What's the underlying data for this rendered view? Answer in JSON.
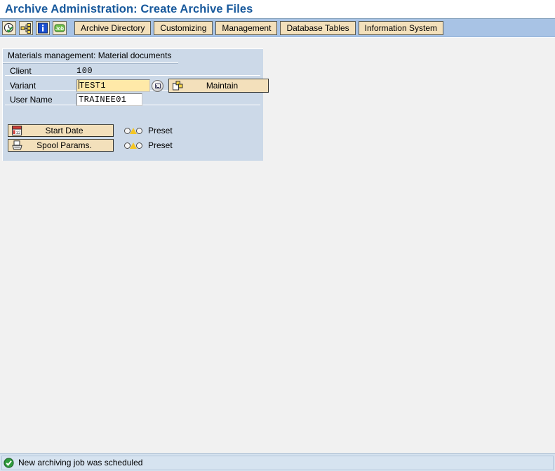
{
  "window": {
    "title": "Archive Administration: Create Archive Files"
  },
  "toolbar": {
    "icons": [
      {
        "name": "schedule-clock-icon",
        "label": "Execute / Schedule"
      },
      {
        "name": "hierarchy-network-icon",
        "label": "Object Hierarchy"
      },
      {
        "name": "info-icon",
        "label": "Information"
      },
      {
        "name": "job-icon",
        "label": "Job Overview"
      }
    ],
    "buttons": [
      {
        "label": "Archive Directory"
      },
      {
        "label": "Customizing"
      },
      {
        "label": "Management"
      },
      {
        "label": "Database Tables"
      },
      {
        "label": "Information System"
      }
    ]
  },
  "panel": {
    "header": "Materials management: Material documents",
    "fields": {
      "client": {
        "label": "Client",
        "value": "100"
      },
      "variant": {
        "label": "Variant",
        "value": "TEST1",
        "placeholder": "",
        "f4_help_name": "value-help-icon"
      },
      "user_name": {
        "label": "User Name",
        "value": "TRAINEE01",
        "placeholder": ""
      }
    },
    "maintain_button": {
      "label": "Maintain",
      "icon": "variant-maintain-icon"
    },
    "actions": [
      {
        "label": "Start Date",
        "icon": "calendar-icon",
        "status": "Preset",
        "status_indicator": "warning-triangle"
      },
      {
        "label": "Spool Params.",
        "icon": "printer-icon",
        "status": "Preset",
        "status_indicator": "warning-triangle"
      }
    ]
  },
  "statusbar": {
    "icon": "success-check-icon",
    "message": "New archiving job was scheduled"
  },
  "colors": {
    "title_text": "#18599c",
    "toolbar_bg": "#a8c3e5",
    "button_bg": "#f3e0bb",
    "panel_bg": "#ccd9e8",
    "required_field_bg": "#ffe9a8",
    "status_bg": "#d6e3f0",
    "success_green": "#2e9b3c",
    "warning_yellow": "#f5c624"
  }
}
